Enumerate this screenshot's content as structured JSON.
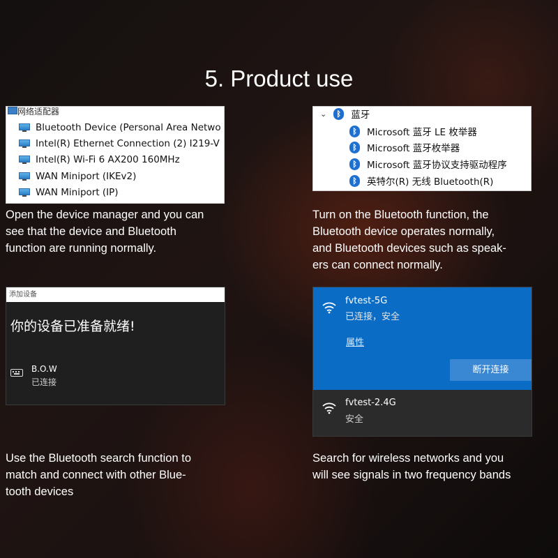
{
  "title": "5. Product use",
  "device_manager": {
    "header": "网络适配器",
    "items": [
      "Bluetooth Device (Personal Area Netwo",
      "Intel(R) Ethernet Connection (2) I219-V",
      "Intel(R) Wi-Fi 6 AX200 160MHz",
      "WAN Miniport (IKEv2)",
      "WAN Miniport (IP)"
    ],
    "caption": "Open the device manager and you can\nsee that the device and Bluetooth\nfunction are running normally."
  },
  "bluetooth_list": {
    "header": "蓝牙",
    "items": [
      "Microsoft 蓝牙 LE 枚举器",
      "Microsoft 蓝牙枚举器",
      "Microsoft 蓝牙协议支持驱动程序",
      "英特尔(R) 无线 Bluetooth(R)"
    ],
    "caption": "Turn on the Bluetooth function, the\nBluetooth device operates normally,\nand Bluetooth devices such as speak-\ners can connect normally."
  },
  "add_device": {
    "bar_title": "添加设备",
    "heading": "你的设备已准备就绪!",
    "device_name": "B.O.W",
    "device_status": "已连接",
    "caption": "Use the Bluetooth search function to\nmatch and connect with other Blue-\ntooth devices"
  },
  "wifi": {
    "networks": [
      {
        "ssid": "fvtest-5G",
        "status": "已连接，安全"
      },
      {
        "ssid": "fvtest-2.4G",
        "status": "安全"
      }
    ],
    "properties_link": "属性",
    "disconnect_button": "断开连接",
    "accent": "#0a6cc4",
    "caption": "Search for wireless networks and you\nwill see signals in two frequency bands"
  }
}
